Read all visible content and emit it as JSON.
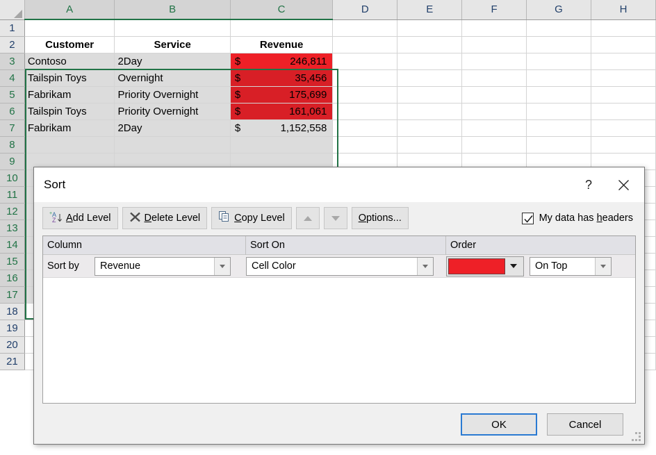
{
  "app": {
    "name": "Microsoft Excel"
  },
  "sheet": {
    "column_headers": [
      "A",
      "B",
      "C",
      "D",
      "E",
      "F",
      "G",
      "H"
    ],
    "selected_columns": [
      "A",
      "B",
      "C"
    ],
    "row_headers": [
      "1",
      "2",
      "3",
      "4",
      "5",
      "6",
      "7",
      "8",
      "9",
      "10",
      "11",
      "12",
      "13",
      "14",
      "15",
      "16",
      "17",
      "18",
      "19",
      "20",
      "21"
    ],
    "selected_rows": [
      "3",
      "4",
      "5",
      "6",
      "7",
      "8",
      "9",
      "10",
      "11",
      "12",
      "13",
      "14",
      "15",
      "16",
      "17"
    ],
    "table_headers": [
      "Customer",
      "Service",
      "Revenue"
    ],
    "rows": [
      {
        "row": "3",
        "customer": "Contoso",
        "service": "2Day",
        "currency": "$",
        "revenue": "246,811",
        "fill": "red-active"
      },
      {
        "row": "4",
        "customer": "Tailspin Toys",
        "service": "Overnight",
        "currency": "$",
        "revenue": "35,456",
        "fill": "red"
      },
      {
        "row": "5",
        "customer": "Fabrikam",
        "service": "Priority Overnight",
        "currency": "$",
        "revenue": "175,699",
        "fill": "red"
      },
      {
        "row": "6",
        "customer": "Tailspin Toys",
        "service": "Priority Overnight",
        "currency": "$",
        "revenue": "161,061",
        "fill": "red"
      },
      {
        "row": "7",
        "customer": "Fabrikam",
        "service": "2Day",
        "currency": "$",
        "revenue": "1,152,558",
        "fill": "none"
      }
    ],
    "colors": {
      "header_fill": "#e6e6e6",
      "header_selected_fill": "#d4d4d4",
      "header_text": "#22406b",
      "header_selected_text": "#217346",
      "selection_outline": "#217346",
      "cell_selected_fill": "#dcdcdc",
      "conditional_red": "#ee2027",
      "conditional_red_selected": "#d81f26",
      "gridline": "#d4d4d4"
    }
  },
  "dialog": {
    "title": "Sort",
    "help_icon": "question-mark-icon",
    "close_icon": "close-icon",
    "toolbar": {
      "add_level": {
        "label_pre": "",
        "accel": "A",
        "label_post": "dd Level",
        "icon": "sort-az-add-icon"
      },
      "delete_level": {
        "accel": "D",
        "label_post": "elete Level",
        "icon": "x-mark-icon"
      },
      "copy_level": {
        "accel": "C",
        "label_post": "opy Level",
        "icon": "copy-pages-icon"
      },
      "move_up": {
        "icon": "triangle-up-icon",
        "enabled": false
      },
      "move_down": {
        "icon": "triangle-down-icon",
        "enabled": false
      },
      "options": "Options...",
      "my_data_has_headers": {
        "pre": "My data has ",
        "accel": "h",
        "post": "eaders",
        "checked": true
      }
    },
    "list_headers": {
      "column": "Column",
      "sort_on": "Sort On",
      "order": "Order"
    },
    "criteria": [
      {
        "prefix_label": "Sort by",
        "column_value": "Revenue",
        "sort_on_value": "Cell Color",
        "order_color": "#ee2027",
        "order_position": "On Top"
      }
    ],
    "footer": {
      "ok": "OK",
      "cancel": "Cancel",
      "ok_is_default": true
    },
    "resize_grip_icon": "resize-grip-icon"
  }
}
